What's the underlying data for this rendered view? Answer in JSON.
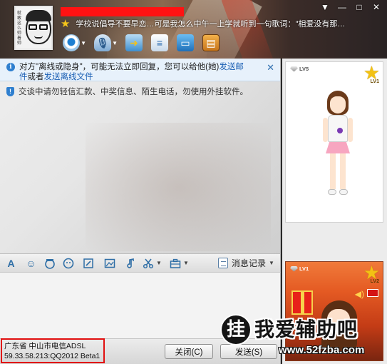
{
  "header": {
    "avatar_vertical_text": "就敢这么帅着帅",
    "signature": "学校说倡导不要早恋…可是我怎么中午一上学就听到一句歌词：\"相爱没有那…",
    "window_controls": {
      "dropdown": "▼",
      "minimize": "—",
      "maximize": "□",
      "close": "✕"
    },
    "toolbar": {
      "video": "video-call",
      "voice": "voice-call",
      "send_file": "transfer-file",
      "notes": "notes",
      "remote": "remote-assist",
      "apps": "apps"
    }
  },
  "notice": {
    "line1_prefix": "对方\"离线或隐身\"，可能无法立即回复，您可以给他(她)",
    "line1_link": "发送邮",
    "line2_link_cont": "件",
    "line2_mid": "或者",
    "line2_link": "发送离线文件",
    "close": "✕"
  },
  "safety": {
    "text": "交谈中请勿轻信汇款、中奖信息、陌生电话，勿使用外挂软件。"
  },
  "format_toolbar": {
    "font": "A",
    "emoji": "☺",
    "history_label": "消息记录",
    "history_dropdown": "▼"
  },
  "location": {
    "line1": "广东省 中山市电信ADSL",
    "line2": "59.33.58.213:QQ2012 Beta1"
  },
  "buttons": {
    "close": "关闭(C)",
    "send": "发送(S)"
  },
  "right_panel": {
    "show1_level": "LV5",
    "show1_star_label": "LV1",
    "show2_level": "LV1",
    "show2_star_label": "LV2"
  },
  "watermark": {
    "badge": "挂",
    "title": "我爱辅助吧",
    "url": "www.52fzba.com"
  },
  "colors": {
    "highlight_red": "#e10f0f",
    "link_blue": "#1a5fb4",
    "star_gold": "#f3c214"
  }
}
